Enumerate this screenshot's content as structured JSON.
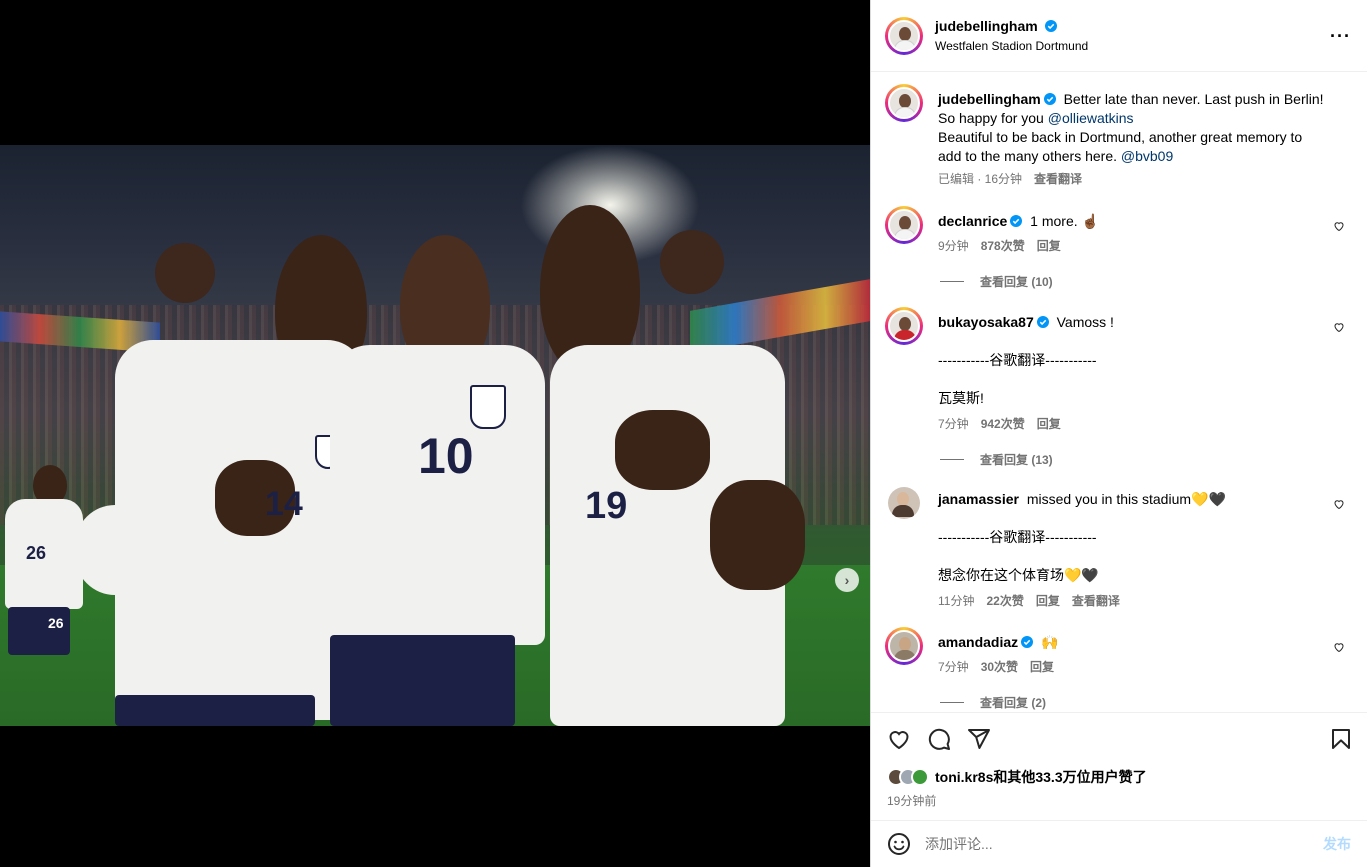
{
  "post": {
    "username": "judebellingham",
    "location": "Westfalen Stadion Dortmund",
    "more_label": "···",
    "media": {
      "dots_total": 5,
      "dots_active": 0,
      "jersey_numbers": [
        "14",
        "10",
        "19",
        "26",
        "26"
      ],
      "next_arrow": "›"
    }
  },
  "caption": {
    "username": "judebellingham",
    "line1": "Better late than never. Last push in Berlin!",
    "line2_prefix": "So happy for you ",
    "mention1": "@olliewatkins",
    "line3": "Beautiful to be back in Dortmund, another great memory to add to the many others here. ",
    "mention2": "@bvb09",
    "meta_edited": "已编辑 · 16分钟",
    "meta_translate": "查看翻译"
  },
  "comments": [
    {
      "username": "declanrice",
      "verified": true,
      "text": "1 more. ☝🏾",
      "time": "9分钟",
      "likes": "878次赞",
      "reply": "回复",
      "view_replies": "查看回复 (10)"
    },
    {
      "username": "bukayosaka87",
      "verified": true,
      "text": "Vamoss !",
      "translation_divider": "-----------谷歌翻译-----------",
      "translation": "瓦莫斯!",
      "time": "7分钟",
      "likes": "942次赞",
      "reply": "回复",
      "view_replies": "查看回复 (13)"
    },
    {
      "username": "janamassier",
      "verified": false,
      "text": "missed you in this stadium💛🖤",
      "translation_divider": "-----------谷歌翻译-----------",
      "translation": "想念你在这个体育场💛🖤",
      "time": "11分钟",
      "likes": "22次赞",
      "reply": "回复",
      "translate": "查看翻译"
    },
    {
      "username": "amandadiaz",
      "verified": true,
      "text": "🙌",
      "time": "7分钟",
      "likes": "30次赞",
      "reply": "回复",
      "view_replies": "查看回复 (2)"
    }
  ],
  "likes_summary": "toni.kr8s和其他33.3万位用户赞了",
  "posted_ago": "19分钟前",
  "compose": {
    "placeholder": "添加评论...",
    "post_label": "发布"
  },
  "colors": {
    "verified": "#0095f6",
    "link": "#00376b",
    "muted": "#737373",
    "post_disabled": "#b3dbff"
  }
}
